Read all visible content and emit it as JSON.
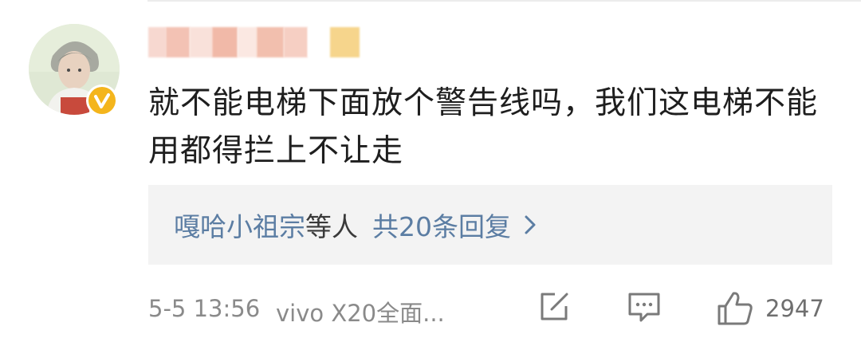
{
  "comment": {
    "text": "就不能电梯下面放个警告线吗，我们这电梯不能用都得拦上不让走"
  },
  "replies": {
    "names": "嘎哈小祖宗",
    "names_suffix": "等人",
    "count_label": "共20条回复"
  },
  "footer": {
    "timestamp": "5-5 13:56",
    "device": "vivo X20全面...",
    "likes": "2947"
  },
  "icons": {
    "edit": "edit-icon",
    "comment": "comment-icon",
    "like": "thumbs-up-icon",
    "verified": "verified-badge-icon",
    "chevron": "chevron-right-icon"
  },
  "colors": {
    "link": "#5b7da3",
    "text": "#1e1e1e",
    "meta": "#8a8a8a",
    "panel": "#f3f3f3",
    "badge": "#f4b51c"
  }
}
